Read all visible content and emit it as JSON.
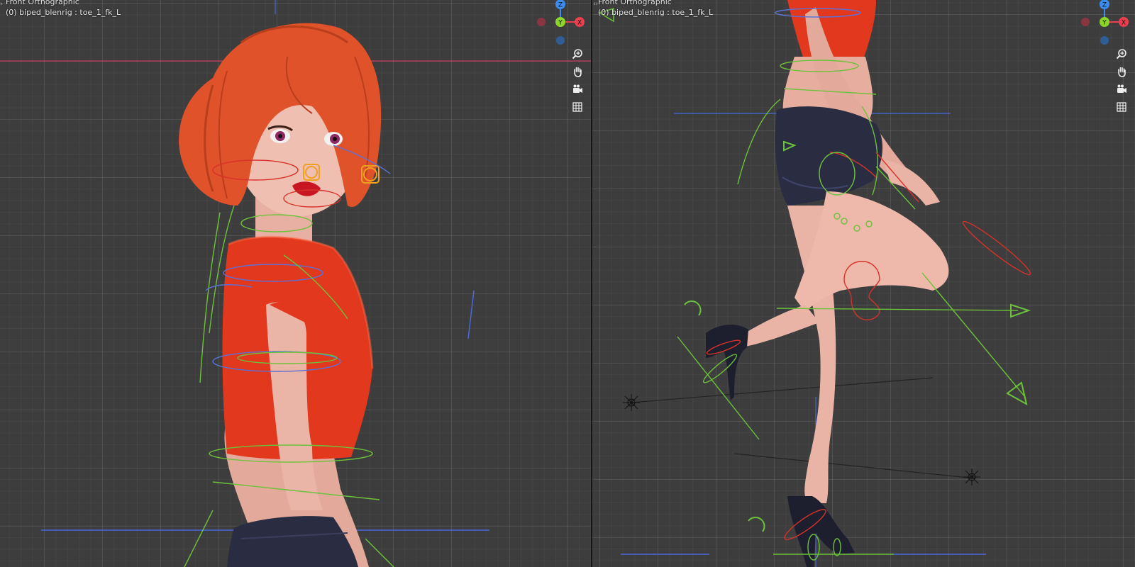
{
  "viewports": [
    {
      "title": "Front Orthographic",
      "subtitle": "(0) biped_blenrig : toe_1_fk_L"
    },
    {
      "title": "Front Orthographic",
      "subtitle": "(0) biped_blenrig : toe_1_fk_L"
    }
  ],
  "gizmo": {
    "axes": {
      "z": "Z",
      "y": "Y",
      "x": "X"
    },
    "colors": {
      "x": "#e8404f",
      "y": "#8bd42a",
      "z": "#3a8cf0",
      "neg_x": "#8a3540",
      "neg_y": "#5e8228",
      "neg_z": "#2f5d96"
    }
  },
  "nav_buttons": [
    {
      "icon": "zoom-in-icon"
    },
    {
      "icon": "hand-pan-icon"
    },
    {
      "icon": "camera-icon"
    },
    {
      "icon": "grid-icon"
    }
  ],
  "colors": {
    "background": "#3d3d3d",
    "grid": "#4a4a4a",
    "hair": "#e0522a",
    "shirt": "#e2381e",
    "skin": "#e9b3a6",
    "shorts": "#2a2d42",
    "rig_green": "#6cc23a",
    "rig_blue": "#5a72d8",
    "rig_red": "#d8312a",
    "rig_orange": "#f0a020"
  }
}
